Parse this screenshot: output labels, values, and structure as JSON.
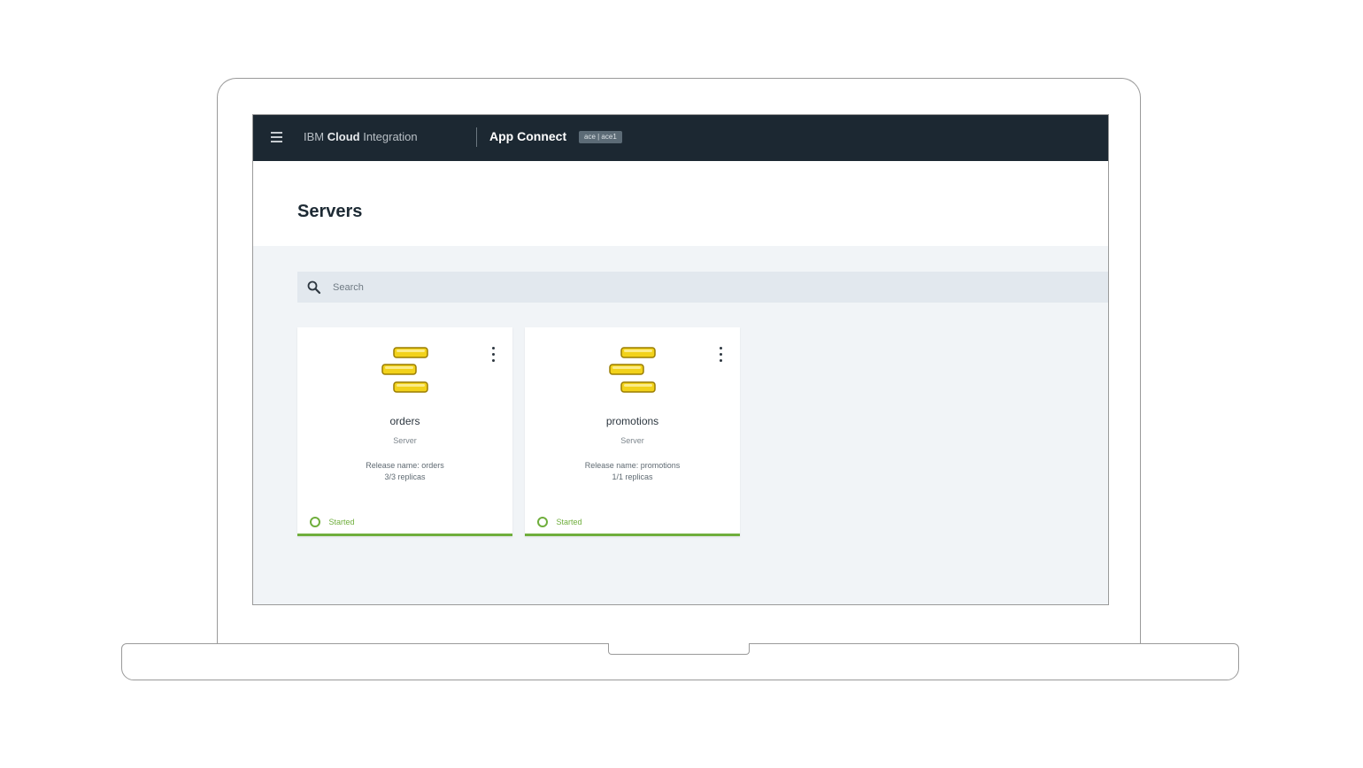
{
  "header": {
    "brand_prefix": "IBM",
    "brand_bold": "Cloud",
    "brand_suffix": "Integration",
    "product": "App Connect",
    "namespace_tag": "ace | ace1"
  },
  "page": {
    "title": "Servers"
  },
  "search": {
    "placeholder": "Search",
    "value": ""
  },
  "servers": [
    {
      "name": "orders",
      "type": "Server",
      "release": "Release name: orders",
      "replicas": "3/3 replicas",
      "status": "Started",
      "icon": "integration-server-icon"
    },
    {
      "name": "promotions",
      "type": "Server",
      "release": "Release name: promotions",
      "replicas": "1/1 replicas",
      "status": "Started",
      "icon": "integration-server-icon"
    }
  ],
  "colors": {
    "header_bg": "#1c2832",
    "status_started": "#6fae3c",
    "server_icon": "#f2d21b",
    "page_bg": "#f1f4f7"
  }
}
